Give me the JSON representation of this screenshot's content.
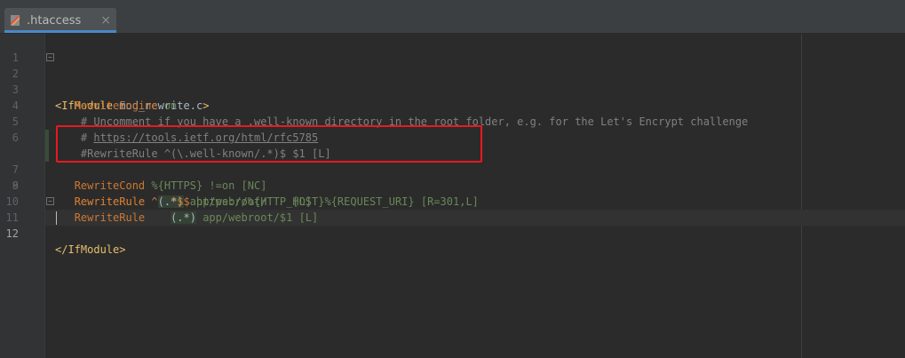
{
  "tab": {
    "label": ".htaccess",
    "close_label": "⨯",
    "icon": "htaccess-file-icon"
  },
  "editor": {
    "line_numbers": [
      "1",
      "2",
      "3",
      "4",
      "5",
      "6",
      "7",
      "8",
      "9",
      "10",
      "11",
      "12"
    ],
    "lines": {
      "l2": {
        "open": "<",
        "tag": "IfModule",
        "arg": " mod_rewrite.c",
        "close": ">"
      },
      "l3": {
        "directive": "RewriteEngine",
        "value": " on"
      },
      "l4": {
        "comment": "# Uncomment if you have a .well-known directory in the root folder, e.g. for the Let's Encrypt challenge"
      },
      "l5": {
        "hash": "# ",
        "link": "https://tools.ietf.org/html/rfc5785"
      },
      "l6": {
        "comment": "#RewriteRule ^(\\.well-known/.*)$ $1 [L]"
      },
      "l7": {
        "directive": "RewriteCond",
        "var": " %{HTTPS}",
        "rest": " !=on [NC]"
      },
      "l8": {
        "directive": "RewriteRule",
        "caret": " ^",
        "group": "(.*)",
        "dollar": "$",
        "target": " https://%{HTTP_HOST}%{REQUEST_URI}",
        "flags": " [R=301,L]"
      },
      "l9": {
        "directive": "RewriteRule",
        "caret": "    ^",
        "dollar": "$",
        "target": " app/webroot/",
        "flags": "    [L]"
      },
      "l10": {
        "directive": "RewriteRule",
        "pad": "    ",
        "group": "(.*)",
        "target": " app/webroot/$1",
        "flags": " [L]"
      },
      "l11": {
        "open": "</",
        "tag": "IfModule",
        "close": ">"
      }
    }
  },
  "colors": {
    "annotation_box": "#e8191f",
    "background": "#2b2b2b",
    "tab_accent": "#4a88c7"
  }
}
